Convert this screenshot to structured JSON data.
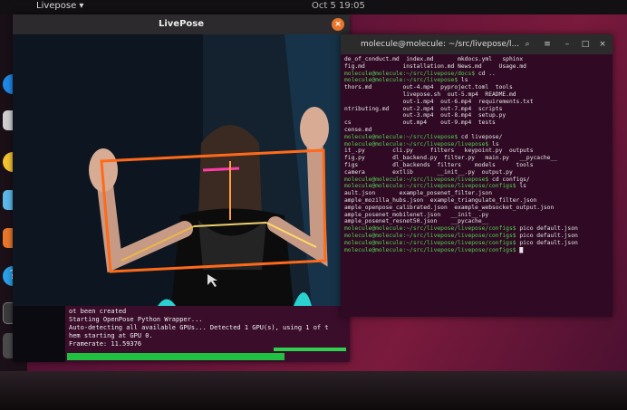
{
  "topbar": {
    "app_menu": "Livepose ▾",
    "clock": "Oct 5 19:05"
  },
  "livepose_window": {
    "title": "LivePose",
    "console_lines": [
      "ot been created",
      "Starting OpenPose Python Wrapper...",
      "Auto-detecting all available GPUs... Detected 1 GPU(s), using 1 of t",
      "hem starting at GPU 0.",
      "Framerate: 11.59376"
    ]
  },
  "terminal": {
    "title": "molecule@molecule: ~/src/livepose/l...",
    "lines": [
      {
        "p": "",
        "t": "de_of_conduct.md  index.md       mkdocs.yml   sphinx"
      },
      {
        "p": "",
        "t": "fig.md           installation.md News.md     Usage.md"
      },
      {
        "p": "molecule@molecule:~/src/livepose/docs$",
        "t": " cd .."
      },
      {
        "p": "molecule@molecule:~/src/livepose$",
        "t": " ls"
      },
      {
        "p": "",
        "t": "thors.md         out-4.mp4  pyproject.toml  tools"
      },
      {
        "p": "",
        "t": "                 livepose.sh  out-5.mp4  README.md"
      },
      {
        "p": "",
        "t": "                 out-1.mp4  out-6.mp4  requirements.txt"
      },
      {
        "p": "",
        "t": "ntributing.md    out-2.mp4  out-7.mp4  scripts"
      },
      {
        "p": "",
        "t": "                 out-3.mp4  out-8.mp4  setup.py"
      },
      {
        "p": "",
        "t": "cs               out.mp4    out-9.mp4  tests"
      },
      {
        "p": "",
        "t": "cense.md"
      },
      {
        "p": "molecule@molecule:~/src/livepose$",
        "t": " cd livepose/"
      },
      {
        "p": "molecule@molecule:~/src/livepose/livepose$",
        "t": " ls"
      },
      {
        "p": "",
        "t": "it_.py        cli.py     filters   keypoint.py  outputs"
      },
      {
        "p": "",
        "t": "fig.py        dl_backend.py  filter.py   main.py   __pycache__"
      },
      {
        "p": "",
        "t": "figs          dl_backends  filters    models      tools"
      },
      {
        "p": "",
        "t": "camera        extlib       __init__.py  output.py"
      },
      {
        "p": "molecule@molecule:~/src/livepose/livepose$",
        "t": " cd configs/"
      },
      {
        "p": "molecule@molecule:~/src/livepose/livepose/configs$",
        "t": " ls"
      },
      {
        "p": "",
        "t": "ault.json       example_posenet_filter.json"
      },
      {
        "p": "",
        "t": "ample_mozilla_hubs.json  example_triangulate_filter.json"
      },
      {
        "p": "",
        "t": "ample_openpose_calibrated.json  example_websocket_output.json"
      },
      {
        "p": "",
        "t": "ample_posenet_mobilenet.json   __init__.py"
      },
      {
        "p": "",
        "t": "ample_posenet_resnet50.json    __pycache__"
      },
      {
        "p": "molecule@molecule:~/src/livepose/livepose/configs$",
        "t": " pico default.json"
      },
      {
        "p": "molecule@molecule:~/src/livepose/livepose/configs$",
        "t": " pico default.json"
      },
      {
        "p": "molecule@molecule:~/src/livepose/livepose/configs$",
        "t": " pico default.json"
      },
      {
        "p": "molecule@molecule:~/src/livepose/livepose/configs$",
        "t": " █"
      }
    ]
  }
}
